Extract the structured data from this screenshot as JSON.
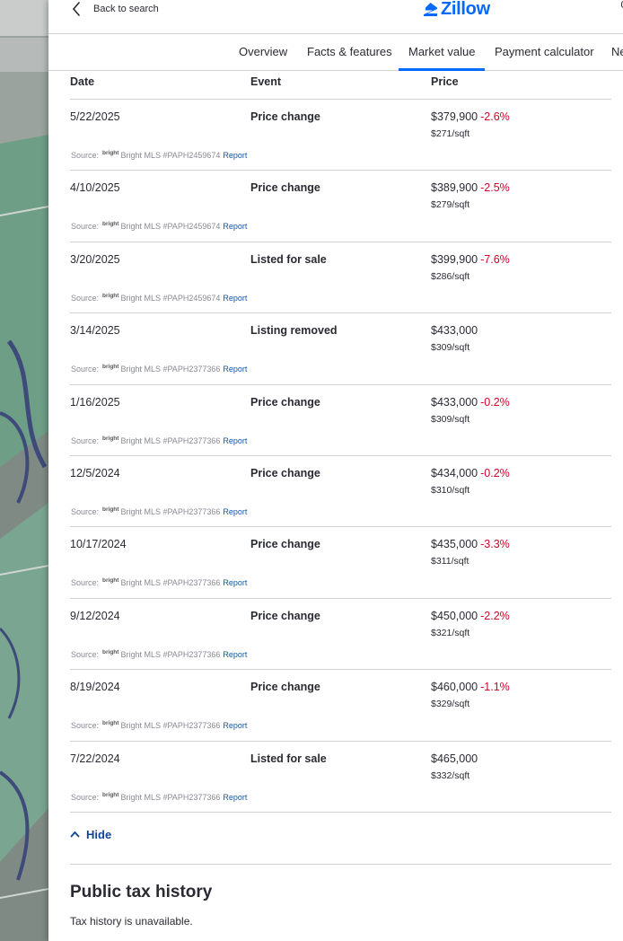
{
  "header": {
    "back_label": "Back to search",
    "logo_text": "Zillow",
    "brand_color": "#006aff"
  },
  "tabs": [
    {
      "label": "Overview"
    },
    {
      "label": "Facts & features"
    },
    {
      "label": "Market value",
      "active": true
    },
    {
      "label": "Payment calculator"
    },
    {
      "label": "Ne"
    }
  ],
  "price_history": {
    "columns": {
      "date": "Date",
      "event": "Event",
      "price": "Price"
    },
    "source_prefix": "Source:",
    "source_logo_text": "bright",
    "report_label": "Report",
    "rows": [
      {
        "date": "5/22/2025",
        "event": "Price change",
        "price": "$379,900",
        "change": "-2.6%",
        "per_sqft": "$271/sqft",
        "source": "Bright MLS #PAPH2459674"
      },
      {
        "date": "4/10/2025",
        "event": "Price change",
        "price": "$389,900",
        "change": "-2.5%",
        "per_sqft": "$279/sqft",
        "source": "Bright MLS #PAPH2459674"
      },
      {
        "date": "3/20/2025",
        "event": "Listed for sale",
        "price": "$399,900",
        "change": "-7.6%",
        "per_sqft": "$286/sqft",
        "source": "Bright MLS #PAPH2459674"
      },
      {
        "date": "3/14/2025",
        "event": "Listing removed",
        "price": "$433,000",
        "change": "",
        "per_sqft": "$309/sqft",
        "source": "Bright MLS #PAPH2377366"
      },
      {
        "date": "1/16/2025",
        "event": "Price change",
        "price": "$433,000",
        "change": "-0.2%",
        "per_sqft": "$309/sqft",
        "source": "Bright MLS #PAPH2377366"
      },
      {
        "date": "12/5/2024",
        "event": "Price change",
        "price": "$434,000",
        "change": "-0.2%",
        "per_sqft": "$310/sqft",
        "source": "Bright MLS #PAPH2377366"
      },
      {
        "date": "10/17/2024",
        "event": "Price change",
        "price": "$435,000",
        "change": "-3.3%",
        "per_sqft": "$311/sqft",
        "source": "Bright MLS #PAPH2377366"
      },
      {
        "date": "9/12/2024",
        "event": "Price change",
        "price": "$450,000",
        "change": "-2.2%",
        "per_sqft": "$321/sqft",
        "source": "Bright MLS #PAPH2377366"
      },
      {
        "date": "8/19/2024",
        "event": "Price change",
        "price": "$460,000",
        "change": "-1.1%",
        "per_sqft": "$329/sqft",
        "source": "Bright MLS #PAPH2377366"
      },
      {
        "date": "7/22/2024",
        "event": "Listed for sale",
        "price": "$465,000",
        "change": "",
        "per_sqft": "$332/sqft",
        "source": "Bright MLS #PAPH2377366"
      }
    ],
    "hide_label": "Hide",
    "negative_color": "#d1042a",
    "link_color": "#0d5aa7"
  },
  "tax_history": {
    "title": "Public tax history",
    "message": "Tax history is unavailable."
  }
}
